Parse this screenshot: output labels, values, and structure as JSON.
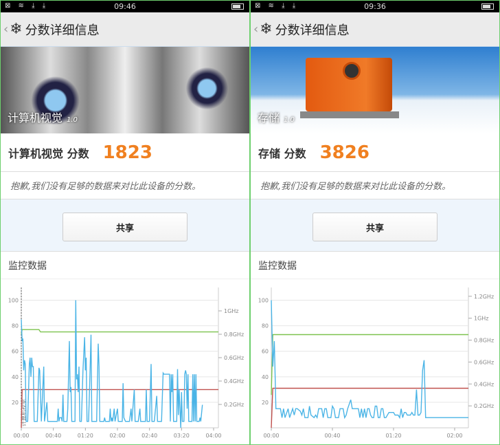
{
  "panels": [
    {
      "status": {
        "time": "09:46",
        "icons": "⊠ ≋ ⤓ ⤓"
      },
      "header": {
        "title": "分数详细信息"
      },
      "hero": {
        "label": "计算机视觉",
        "version": "1.0"
      },
      "score": {
        "name": "计算机视觉 分数",
        "value": "1823"
      },
      "sorry": "抱歉,我们没有足够的数据来对比此设备的分数。",
      "share": "共享",
      "monitor_title": "监控数据"
    },
    {
      "status": {
        "time": "09:36",
        "icons": "⊠ ≋ ⤓ ⤓"
      },
      "header": {
        "title": "分数详细信息"
      },
      "hero": {
        "label": "存储",
        "version": "1.0"
      },
      "score": {
        "name": "存储 分数",
        "value": "3826"
      },
      "sorry": "抱歉,我们没有足够的数据来对比此设备的分数。",
      "share": "共享",
      "monitor_title": "监控数据"
    }
  ],
  "chart_data": [
    {
      "type": "line",
      "title": "监控数据",
      "marker_label": "计算机视觉",
      "x_ticks": [
        "00:00",
        "00:40",
        "01:20",
        "02:00",
        "02:40",
        "03:20",
        "04:00"
      ],
      "x_tick_min": [
        0,
        40,
        80,
        120,
        160,
        200,
        240
      ],
      "xlim": [
        0,
        246
      ],
      "y_ticks": [
        20,
        40,
        60,
        80,
        100
      ],
      "ylim": [
        0,
        110
      ],
      "y2_ticks": [
        "0.2GHz",
        "0.4GHz",
        "0.6GHz",
        "0.8GHz",
        "1GHz"
      ],
      "y2_tick_values": [
        0.2,
        0.4,
        0.6,
        0.8,
        1.0
      ],
      "y2lim": [
        0,
        1.2
      ],
      "series": [
        {
          "name": "cpu_load",
          "axis": "left",
          "color": "#4ab4e6",
          "x": [
            0,
            1,
            2,
            3,
            4,
            5,
            6,
            8,
            10,
            11,
            12,
            13,
            14,
            15,
            16,
            20,
            22,
            23,
            25,
            28,
            29,
            32,
            33,
            45,
            46,
            47,
            48,
            50,
            51,
            52,
            53,
            57,
            58,
            60,
            61,
            62,
            63,
            67,
            68,
            69,
            70,
            71,
            72,
            73,
            75,
            77,
            79,
            80,
            81,
            82,
            84,
            86,
            87,
            88,
            94,
            96,
            97,
            98,
            103,
            104,
            105,
            110,
            111,
            112,
            113,
            114,
            116,
            117,
            120,
            121,
            126,
            127,
            128,
            130,
            135,
            137,
            138,
            141,
            142,
            146,
            148,
            149,
            155,
            156,
            157,
            160,
            162,
            163,
            166,
            169,
            170,
            175,
            177,
            178,
            185,
            186,
            187,
            188,
            189,
            190,
            194,
            195,
            196,
            197,
            199,
            200,
            201,
            203,
            204,
            205,
            206,
            207,
            208,
            209,
            213,
            214,
            215,
            216,
            217,
            218,
            219,
            222,
            223,
            224,
            226
          ],
          "y": [
            85,
            68,
            70,
            45,
            53,
            50,
            5,
            5,
            50,
            55,
            40,
            55,
            48,
            48,
            5,
            5,
            47,
            45,
            5,
            48,
            5,
            20,
            5,
            5,
            15,
            5,
            8,
            8,
            5,
            26,
            5,
            5,
            15,
            68,
            28,
            32,
            5,
            5,
            100,
            38,
            42,
            28,
            48,
            5,
            5,
            45,
            71,
            45,
            55,
            5,
            5,
            48,
            73,
            5,
            5,
            66,
            48,
            5,
            5,
            8,
            5,
            5,
            15,
            5,
            8,
            5,
            15,
            5,
            15,
            5,
            5,
            35,
            8,
            5,
            5,
            15,
            5,
            30,
            5,
            5,
            15,
            5,
            5,
            30,
            5,
            5,
            50,
            5,
            5,
            25,
            5,
            5,
            43,
            42,
            42,
            5,
            42,
            28,
            42,
            5,
            5,
            46,
            10,
            30,
            0,
            28,
            5,
            5,
            42,
            45,
            42,
            15,
            42,
            5,
            5,
            42,
            5,
            42,
            5,
            42,
            5,
            5,
            8,
            5,
            18
          ]
        },
        {
          "name": "cpu_freq",
          "axis": "right",
          "color": "#7cc24e",
          "x": [
            0,
            1,
            22,
            24,
            246
          ],
          "y": [
            0.8,
            0.84,
            0.84,
            0.82,
            0.82
          ]
        },
        {
          "name": "temperature",
          "axis": "left",
          "color": "#c0504d",
          "x": [
            0,
            1,
            246
          ],
          "y": [
            0,
            30,
            30
          ]
        }
      ]
    },
    {
      "type": "line",
      "title": "监控数据",
      "x_ticks": [
        "00:00",
        "00:40",
        "01:20",
        "02:00"
      ],
      "x_tick_min": [
        0,
        40,
        80,
        120
      ],
      "xlim": [
        0,
        129
      ],
      "y_ticks": [
        20,
        40,
        60,
        80,
        100
      ],
      "ylim": [
        0,
        110
      ],
      "y2_ticks": [
        "0.2GHz",
        "0.4GHz",
        "0.6GHz",
        "0.8GHz",
        "1GHz",
        "1.2GHz"
      ],
      "y2_tick_values": [
        0.2,
        0.4,
        0.6,
        0.8,
        1.0,
        1.2
      ],
      "y2lim": [
        0,
        1.28
      ],
      "series": [
        {
          "name": "cpu_load",
          "axis": "left",
          "color": "#4ab4e6",
          "x": [
            0,
            1,
            2,
            3,
            6,
            7,
            8,
            9,
            11,
            12,
            14,
            15,
            16,
            17,
            19,
            20,
            21,
            22,
            24,
            25,
            26,
            28,
            29,
            30,
            31,
            33,
            34,
            35,
            36,
            37,
            39,
            40,
            41,
            42,
            44,
            45,
            47,
            48,
            49,
            50,
            52,
            53,
            57,
            58,
            59,
            60,
            61,
            62,
            63,
            64,
            65,
            66,
            67,
            68,
            69,
            70,
            71,
            72,
            73,
            74,
            75,
            77,
            80,
            81,
            83,
            84,
            85,
            86,
            87,
            88,
            89,
            91,
            92,
            93,
            94,
            95,
            96,
            97,
            98,
            99,
            100,
            101,
            129
          ],
          "y": [
            100,
            48,
            68,
            15,
            15,
            8,
            15,
            8,
            15,
            8,
            15,
            10,
            15,
            15,
            13,
            10,
            15,
            8,
            8,
            17,
            10,
            8,
            10,
            8,
            15,
            15,
            8,
            15,
            15,
            8,
            8,
            17,
            15,
            8,
            8,
            15,
            15,
            8,
            10,
            15,
            22,
            15,
            15,
            8,
            15,
            8,
            15,
            8,
            15,
            15,
            10,
            8,
            8,
            17,
            17,
            8,
            8,
            15,
            15,
            8,
            8,
            12,
            12,
            10,
            10,
            8,
            15,
            8,
            12,
            12,
            10,
            10,
            12,
            10,
            10,
            30,
            10,
            10,
            12,
            45,
            53,
            8,
            8
          ]
        },
        {
          "name": "cpu_freq",
          "axis": "right",
          "color": "#7cc24e",
          "x": [
            0,
            1,
            129
          ],
          "y": [
            0.3,
            0.85,
            0.85
          ]
        },
        {
          "name": "temperature",
          "axis": "left",
          "color": "#c0504d",
          "x": [
            0,
            1,
            129
          ],
          "y": [
            0,
            31,
            31
          ]
        }
      ]
    }
  ]
}
